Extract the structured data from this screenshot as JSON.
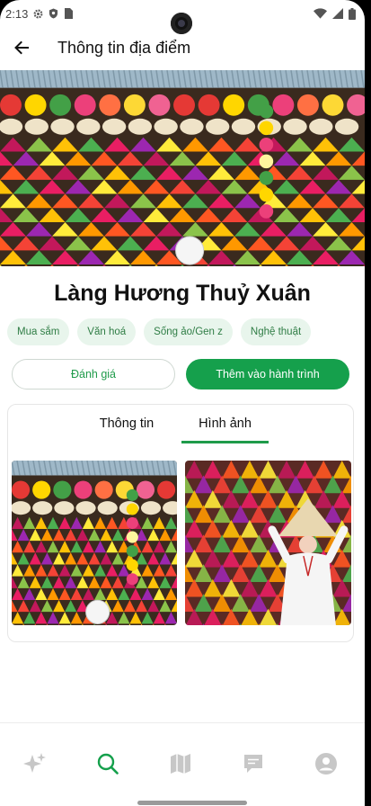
{
  "status_bar": {
    "time": "2:13",
    "icons": [
      "gear-icon",
      "shield-icon",
      "sim-card-icon",
      "wifi-icon",
      "signal-icon",
      "battery-icon"
    ]
  },
  "app_bar": {
    "title": "Thông tin địa điểm",
    "back_icon": "arrow-left-icon"
  },
  "place": {
    "name": "Làng Hương Thuỷ Xuân",
    "tags": [
      "Mua sắm",
      "Văn hoá",
      "Sống ảo/Gen z",
      "Nghệ thuật"
    ]
  },
  "actions": {
    "review_label": "Đánh giá",
    "add_to_trip_label": "Thêm vào hành trình"
  },
  "tabs": {
    "items": [
      "Thông tin",
      "Hình ảnh"
    ],
    "active": "Hình ảnh"
  },
  "photos": [
    "incense-village-photo",
    "woman-with-conical-hat-photo"
  ],
  "bottom_nav": {
    "items": [
      "sparkles-icon",
      "search-icon",
      "map-icon",
      "chat-icon",
      "profile-icon"
    ],
    "active": "search-icon"
  },
  "colors": {
    "accent": "#15a04c",
    "chip_bg": "#e8f5ec",
    "chip_text": "#2f7d45"
  }
}
